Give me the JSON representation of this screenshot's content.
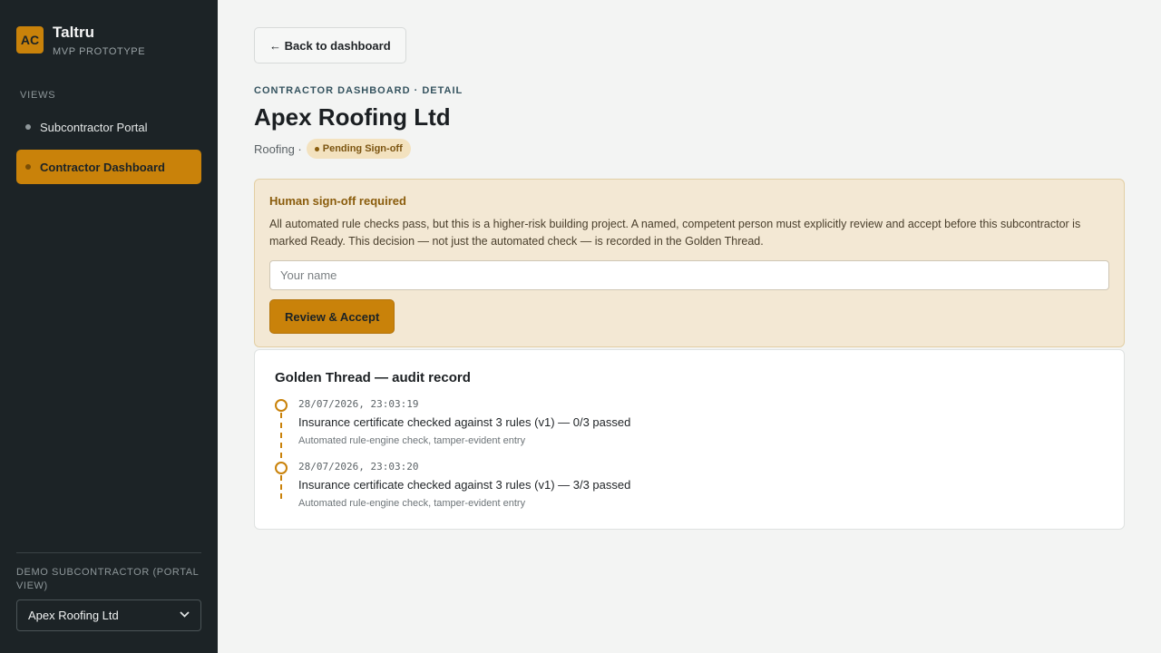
{
  "brand": {
    "logo_initials": "AC",
    "name": "Taltru",
    "subtitle": "MVP PROTOTYPE"
  },
  "sidebar": {
    "views_label": "VIEWS",
    "items": [
      {
        "label": "Subcontractor Portal",
        "active": false
      },
      {
        "label": "Contractor Dashboard",
        "active": true
      }
    ],
    "demo_label": "DEMO SUBCONTRACTOR (PORTAL VIEW)",
    "demo_selected": "Apex Roofing Ltd"
  },
  "header": {
    "back_label": "← Back to dashboard",
    "eyebrow": "CONTRACTOR DASHBOARD · DETAIL",
    "title": "Apex Roofing Ltd",
    "trade": "Roofing ·",
    "status": "Pending Sign-off"
  },
  "signoff": {
    "title": "Human sign-off required",
    "body": "All automated rule checks pass, but this is a higher-risk building project. A named, competent person must explicitly review and accept before this subcontractor is marked Ready. This decision — not just the automated check — is recorded in the Golden Thread.",
    "name_placeholder": "Your name",
    "accept_label": "Review & Accept"
  },
  "audit": {
    "title": "Golden Thread — audit record",
    "entries": [
      {
        "time": "28/07/2026, 23:03:19",
        "text": "Insurance certificate checked against 3 rules (v1) — 0/3 passed",
        "sub": "Automated rule-engine check, tamper-evident entry"
      },
      {
        "time": "28/07/2026, 23:03:20",
        "text": "Insurance certificate checked against 3 rules (v1) — 3/3 passed",
        "sub": "Automated rule-engine check, tamper-evident entry"
      }
    ]
  },
  "colors": {
    "sidebar_bg": "#1c2326",
    "accent": "#c9820a",
    "signoff_bg": "#f3e8d4"
  }
}
